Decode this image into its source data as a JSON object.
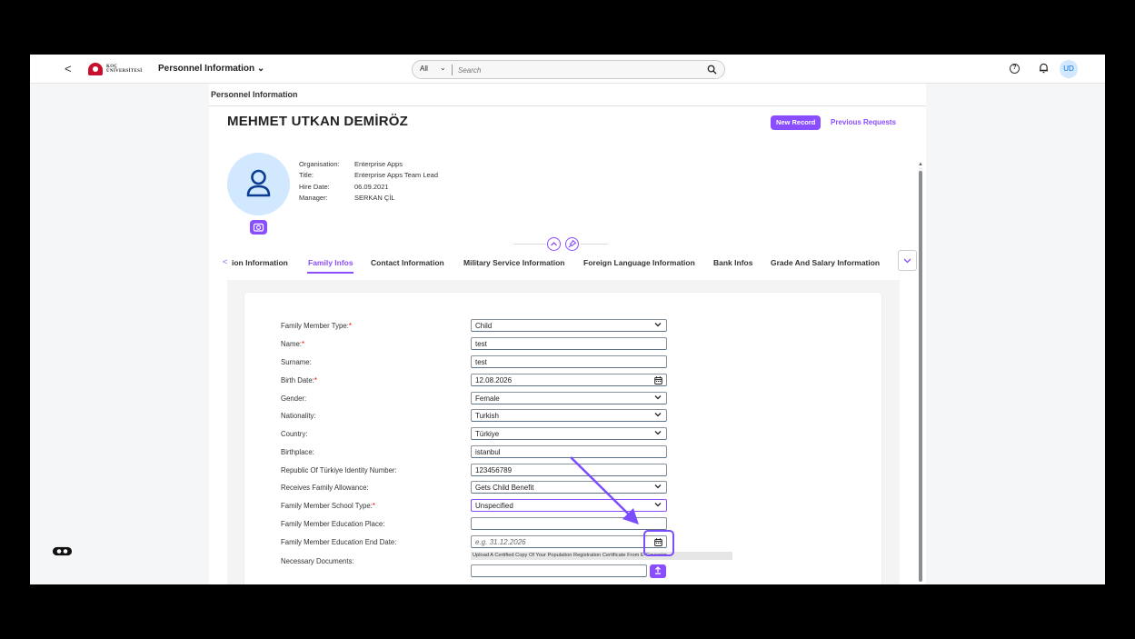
{
  "shellbar": {
    "back": "<",
    "logo_line1": "KOÇ",
    "logo_line2": "ÜNİVERSİTESİ",
    "app_title": "Personnel Information",
    "search_scope": "All",
    "search_placeholder": "Search",
    "avatar_initials": "UD"
  },
  "page": {
    "title": "Personnel Information",
    "employee_name": "MEHMET UTKAN DEMİRÖZ",
    "new_record": "New Record",
    "previous_requests": "Previous Requests",
    "info": [
      {
        "label": "Organisation:",
        "value": "Enterprise Apps"
      },
      {
        "label": "Title:",
        "value": "Enterprise Apps Team Lead"
      },
      {
        "label": "Hire Date:",
        "value": "06.09.2021"
      },
      {
        "label": "Manager:",
        "value": "SERKAN ÇİL"
      }
    ]
  },
  "tabs": [
    {
      "label": "ion Information",
      "active": false
    },
    {
      "label": "Family Infos",
      "active": true
    },
    {
      "label": "Contact Information",
      "active": false
    },
    {
      "label": "Military Service Information",
      "active": false
    },
    {
      "label": "Foreign Language Information",
      "active": false
    },
    {
      "label": "Bank Infos",
      "active": false
    },
    {
      "label": "Grade And Salary Information",
      "active": false
    }
  ],
  "form": {
    "fields": [
      {
        "label": "Family Member Type:",
        "required": true,
        "value": "Child",
        "kind": "select"
      },
      {
        "label": "Name:",
        "required": true,
        "value": "test",
        "kind": "input"
      },
      {
        "label": "Surname:",
        "required": false,
        "value": "test",
        "kind": "input"
      },
      {
        "label": "Birth Date:",
        "required": true,
        "value": "12.08.2026",
        "kind": "date"
      },
      {
        "label": "Gender:",
        "required": false,
        "value": "Female",
        "kind": "select"
      },
      {
        "label": "Nationality:",
        "required": false,
        "value": "Turkish",
        "kind": "select"
      },
      {
        "label": "Country:",
        "required": false,
        "value": "Türkiye",
        "kind": "select"
      },
      {
        "label": "Birthplace:",
        "required": false,
        "value": "istanbul",
        "kind": "input"
      },
      {
        "label": "Republic Of Türkiye Identity Number:",
        "required": false,
        "value": "123456789",
        "kind": "input"
      },
      {
        "label": "Receives Family Allowance:",
        "required": false,
        "value": "Gets Child Benefit",
        "kind": "select"
      },
      {
        "label": "Family Member School Type:",
        "required": true,
        "value": "Unspecified",
        "kind": "select"
      },
      {
        "label": "Family Member Education Place:",
        "required": false,
        "value": "",
        "kind": "input"
      },
      {
        "label": "Family Member Education End Date:",
        "required": false,
        "value": "",
        "placeholder": "e.g. 31.12.2026",
        "kind": "date"
      }
    ],
    "documents_label": "Necessary Documents:",
    "documents_hint": "Upload A Certified Copy Of Your Population Registration Certificate From E-Governm..."
  },
  "colors": {
    "accent": "#8a4dff",
    "annotation": "#7b4dff"
  }
}
